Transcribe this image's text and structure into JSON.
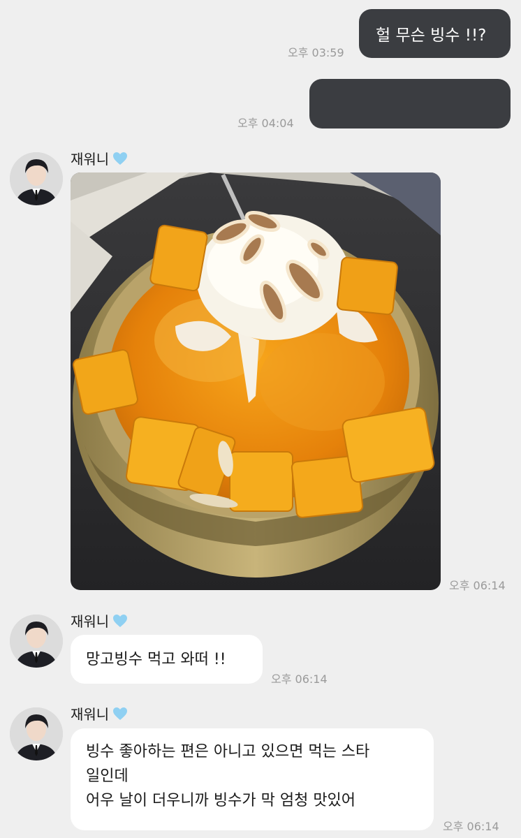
{
  "messages": {
    "m1": {
      "text": "헐 무슨 빙수 !!?",
      "time": "오후 03:59"
    },
    "m2": {
      "text": "",
      "time": "오후 04:04"
    },
    "m3": {
      "sender": "재워니",
      "time": "오후 06:14"
    },
    "m4": {
      "sender": "재워니",
      "text": "망고빙수 먹고 와떠 !!",
      "time": "오후 06:14"
    },
    "m5": {
      "sender": "재워니",
      "lines": [
        "빙수 좋아하는 편은 아니고 있으면 먹는 스타",
        "일인데",
        "어우 날이 더우니까 빙수가 막 엄청 맛있어"
      ],
      "time": "오후 06:14"
    }
  },
  "icons": {
    "heart": "blue-heart-icon"
  },
  "colors": {
    "background": "#efefef",
    "outgoing_bubble": "#3b3d41",
    "incoming_bubble": "#ffffff",
    "heart": "#8fd0f2"
  }
}
